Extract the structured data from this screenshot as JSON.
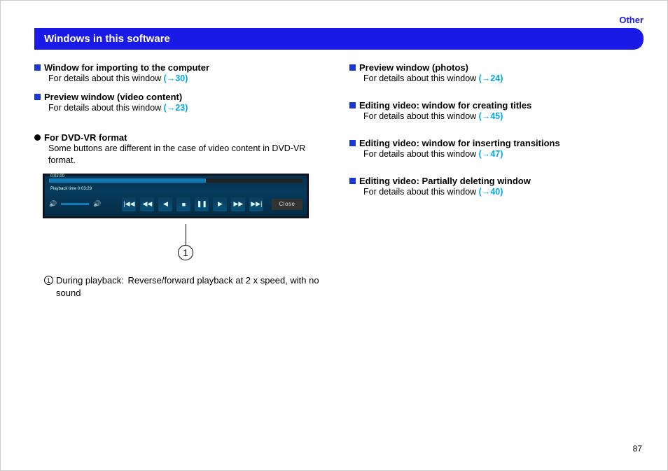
{
  "header": {
    "other": "Other",
    "title": "Windows in this software"
  },
  "left": {
    "items": [
      {
        "title": "Window for importing to the computer",
        "sub": "For details about this window ",
        "link": "(→30)"
      },
      {
        "title": "Preview window (video content)",
        "sub": "For details about this window ",
        "link": "(→23)"
      }
    ],
    "dvd": {
      "title": "For DVD-VR format",
      "desc": "Some buttons are different in the case of video content in DVD-VR format."
    }
  },
  "right": {
    "items": [
      {
        "title": "Preview window (photos)",
        "sub": "For details about this window ",
        "link": "(→24)"
      },
      {
        "title": "Editing video: window for creating titles",
        "sub": "For details about this window ",
        "link": "(→45)"
      },
      {
        "title": "Editing video: window for inserting transitions",
        "sub": "For details about this window ",
        "link": "(→47)"
      },
      {
        "title": "Editing video: Partially deleting window",
        "sub": "For details about this window ",
        "link": "(→40)"
      }
    ]
  },
  "player": {
    "elapsed": "0:02:00",
    "playback_label": "Playback time  0:03:29",
    "close": "Close"
  },
  "callout": {
    "num": "1",
    "label": "During playback:",
    "text": "Reverse/forward playback at 2 x speed, with no sound"
  },
  "page": "87"
}
